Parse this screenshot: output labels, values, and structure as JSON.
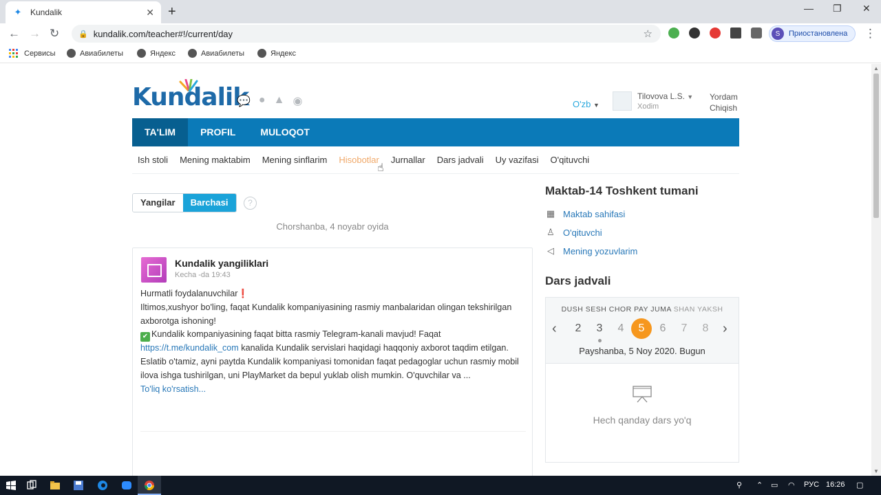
{
  "browser": {
    "tab_title": "Kundalik",
    "tab_close": "✕",
    "new_tab": "+",
    "url": "kundalik.com/teacher#!/current/day",
    "profile_initial": "S",
    "profile_status": "Приостановлена",
    "bookmarks": [
      "Сервисы",
      "Авиабилеты",
      "Яндекс",
      "Авиабилеты",
      "Яндекс"
    ]
  },
  "header": {
    "logo_text": "Kundalik",
    "lang": "O'zb",
    "user_name": "Tilovova L.S.",
    "user_role": "Xodim",
    "help": "Yordam",
    "exit": "Chiqish"
  },
  "main_nav": [
    "TA'LIM",
    "PROFIL",
    "MULOQOT"
  ],
  "sub_nav": [
    "Ish stoli",
    "Mening maktabim",
    "Mening sinflarim",
    "Hisobotlar",
    "Jurnallar",
    "Dars jadvali",
    "Uy vazifasi",
    "O'qituvchi"
  ],
  "filter": {
    "new": "Yangilar",
    "all": "Barchasi",
    "help": "?"
  },
  "feed_date": "Chorshanba, 4 noyabr oyida",
  "news": {
    "title": "Kundalik yangiliklari",
    "time": "Kecha -da 19:43",
    "line1": "Hurmatli foydalanuvchilar",
    "line1_mark": "❗",
    "para1": "Iltimos,xushyor bo'ling, faqat Kundalik kompaniyasining rasmiy manbalaridan olingan tekshirilgan axborotga ishoning!",
    "para2_start": "Kundalik kompaniyasining faqat bitta rasmiy Telegram-kanali mavjud! Faqat",
    "para2_link": "https://t.me/kundalik_com",
    "para2_end": " kanalida Kundalik servislari haqidagi haqqoniy axborot taqdim etilgan.",
    "para3": "Eslatib o'tamiz, ayni paytda Kundalik kompaniyasi tomonidan faqat pedagoglar uchun rasmiy mobil ilova ishga tushirilgan, uni PlayMarket da bepul yuklab olish mumkin. O'quvchilar va ...",
    "more": "To'liq ko'rsatish..."
  },
  "sidebar": {
    "school_title": "Maktab-14 Toshkent tumani",
    "links": [
      "Maktab sahifasi",
      "O'qituvchi",
      "Mening yozuvlarim"
    ],
    "schedule_title": "Dars jadvali"
  },
  "calendar": {
    "weekdays": "DUSH SESH CHOR PAY JUMA",
    "weekend": "SHAN YAKSH",
    "days": [
      "2",
      "3",
      "4",
      "5",
      "6",
      "7",
      "8"
    ],
    "selected_day": "5",
    "today_text": "Payshanba, 5 Noy 2020. Bugun",
    "empty_text": "Hech qanday dars yo'q"
  },
  "taskbar": {
    "lang": "РУС",
    "time": "16:26"
  },
  "colors": {
    "nav_blue": "#0b7ab8",
    "nav_active": "#075f90",
    "accent_cyan": "#1aa3d9",
    "selected_orange": "#f6971e",
    "link_blue": "#2878b8"
  }
}
